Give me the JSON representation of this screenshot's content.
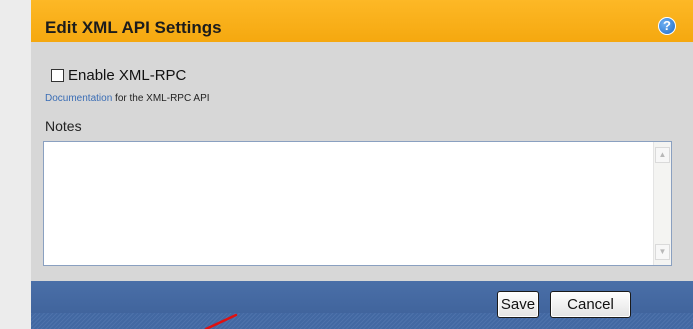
{
  "dialog": {
    "title": "Edit XML API Settings",
    "help_icon": "question-mark-icon",
    "accent_color": "#f5a80f",
    "footer_color": "#3c5f97"
  },
  "form": {
    "enable_label": "Enable XML-RPC",
    "enable_checked": false,
    "doc_link_text": "Documentation",
    "doc_suffix": " for the XML-RPC API",
    "notes_label": "Notes",
    "notes_value": ""
  },
  "buttons": {
    "save_label": "Save",
    "cancel_label": "Cancel"
  }
}
